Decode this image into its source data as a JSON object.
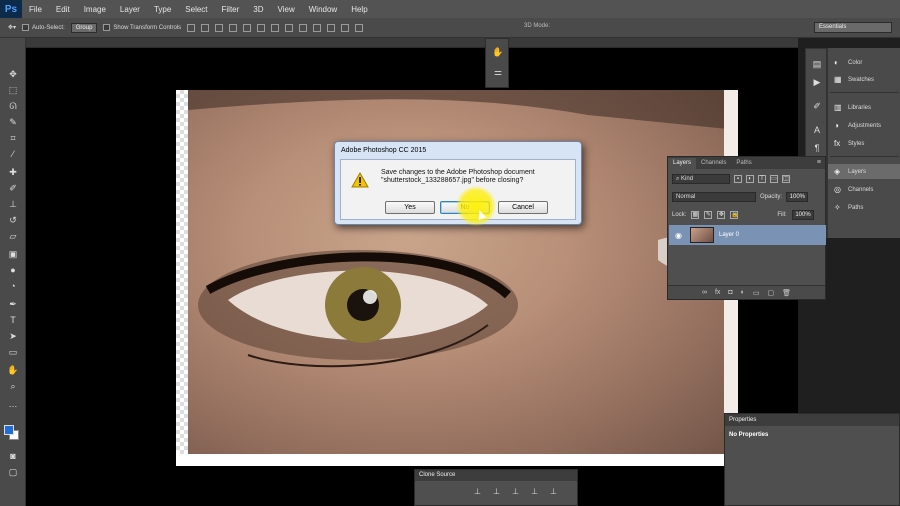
{
  "app": {
    "logo": "Ps"
  },
  "menu": [
    "File",
    "Edit",
    "Image",
    "Layer",
    "Type",
    "Select",
    "Filter",
    "3D",
    "View",
    "Window",
    "Help"
  ],
  "options_bar": {
    "auto_select_label": "Auto-Select:",
    "group_value": "Group",
    "show_transform_label": "Show Transform Controls",
    "mode_3d_label": "3D Mode:",
    "workspace": "Essentials"
  },
  "dialog": {
    "title": "Adobe Photoshop CC 2015",
    "message": "Save changes to the Adobe Photoshop document \"shutterstock_133288657.jpg\" before closing?",
    "yes": "Yes",
    "no": "No",
    "cancel": "Cancel"
  },
  "dock_panels": [
    {
      "label": "Color",
      "icon": "color-icon"
    },
    {
      "label": "Swatches",
      "icon": "swatches-icon"
    },
    {
      "label": "Libraries",
      "icon": "libraries-icon"
    },
    {
      "label": "Adjustments",
      "icon": "adjustments-icon"
    },
    {
      "label": "Styles",
      "icon": "styles-icon"
    },
    {
      "label": "Layers",
      "icon": "layers-icon"
    },
    {
      "label": "Channels",
      "icon": "channels-icon"
    },
    {
      "label": "Paths",
      "icon": "paths-icon"
    }
  ],
  "layers_panel": {
    "tabs": [
      "Layers",
      "Channels",
      "Paths"
    ],
    "kind": "Kind",
    "blend_mode": "Normal",
    "opacity_label": "Opacity:",
    "opacity_value": "100%",
    "lock_label": "Lock:",
    "fill_label": "Fill:",
    "fill_value": "100%",
    "layer_name": "Layer 0"
  },
  "properties_panel": {
    "title": "Properties",
    "body": "No Properties"
  },
  "clone_source": {
    "title": "Clone Source"
  },
  "colors": {
    "foreground": "#1f6fd6",
    "background": "#ffffff",
    "highlight": "#fff000"
  }
}
